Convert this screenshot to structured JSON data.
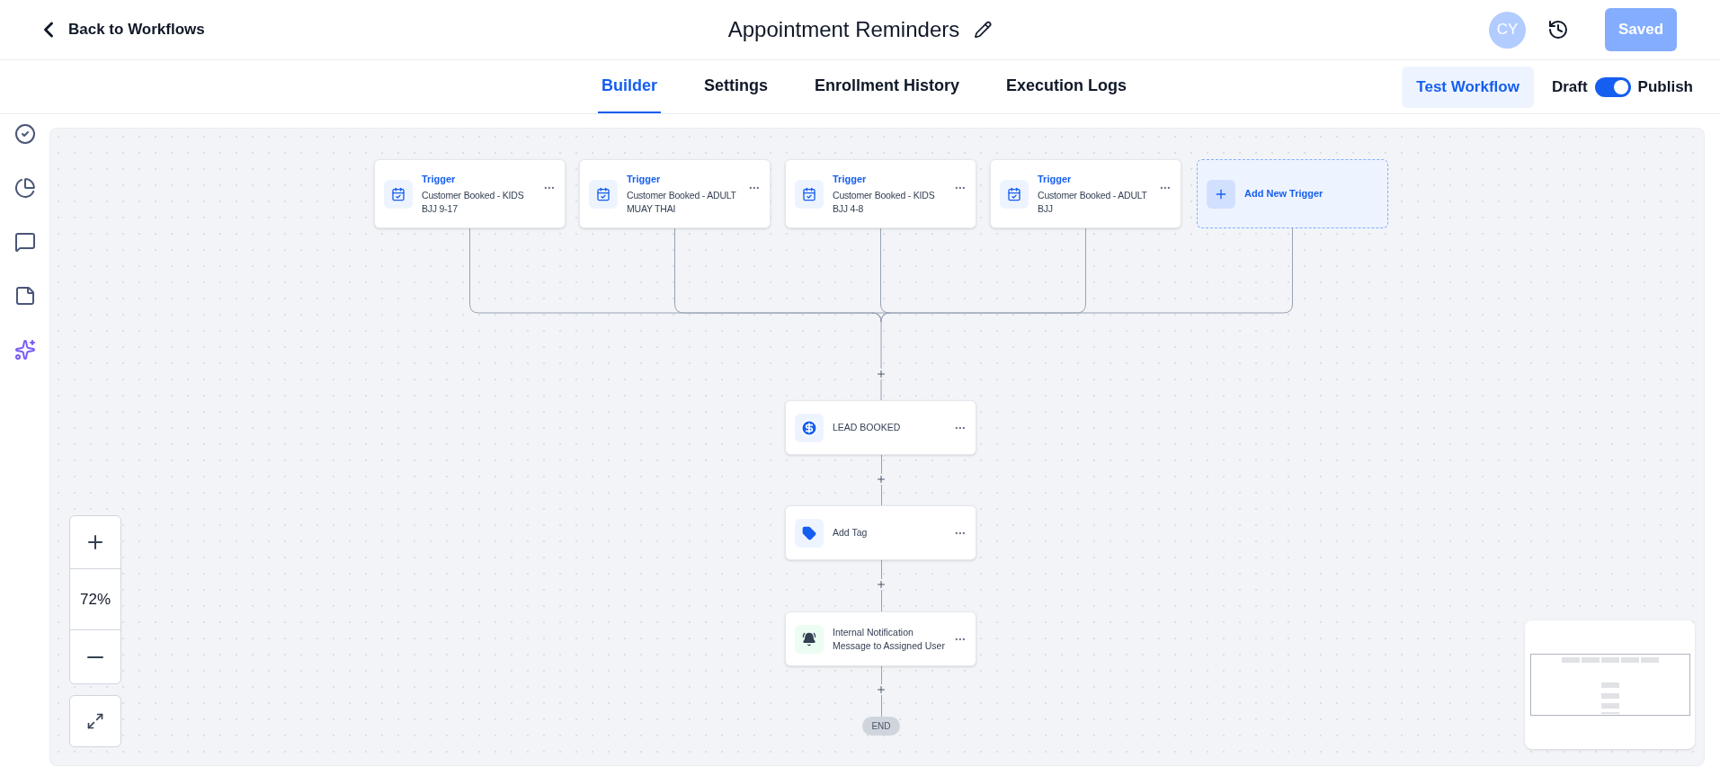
{
  "header": {
    "back": "Back to Workflows",
    "title": "Appointment Reminders",
    "avatar": "CY",
    "save": "Saved"
  },
  "tabs": [
    {
      "label": "Builder",
      "selected": true
    },
    {
      "label": "Settings",
      "selected": false
    },
    {
      "label": "Enrollment History",
      "selected": false
    },
    {
      "label": "Execution Logs",
      "selected": false
    }
  ],
  "test_button": "Test Workflow",
  "publish": {
    "off_label": "Draft",
    "on_label": "Publish",
    "on": true
  },
  "canvas": {
    "triggers": [
      {
        "label": "Trigger",
        "name": "Customer Booked - KIDS BJJ 9-17"
      },
      {
        "label": "Trigger",
        "name": "Customer Booked - ADULT MUAY THAI"
      },
      {
        "label": "Trigger",
        "name": "Customer Booked - KIDS BJJ 4-8"
      },
      {
        "label": "Trigger",
        "name": "Customer Booked - ADULT BJJ"
      }
    ],
    "add_trigger": "Add New Trigger",
    "actions": [
      {
        "kind": "payment",
        "name": "LEAD BOOKED"
      },
      {
        "kind": "tag",
        "name": "Add Tag"
      },
      {
        "kind": "notification",
        "name": "Internal Notification Message to Assigned User"
      }
    ],
    "end": "END",
    "zoom": "72%"
  }
}
